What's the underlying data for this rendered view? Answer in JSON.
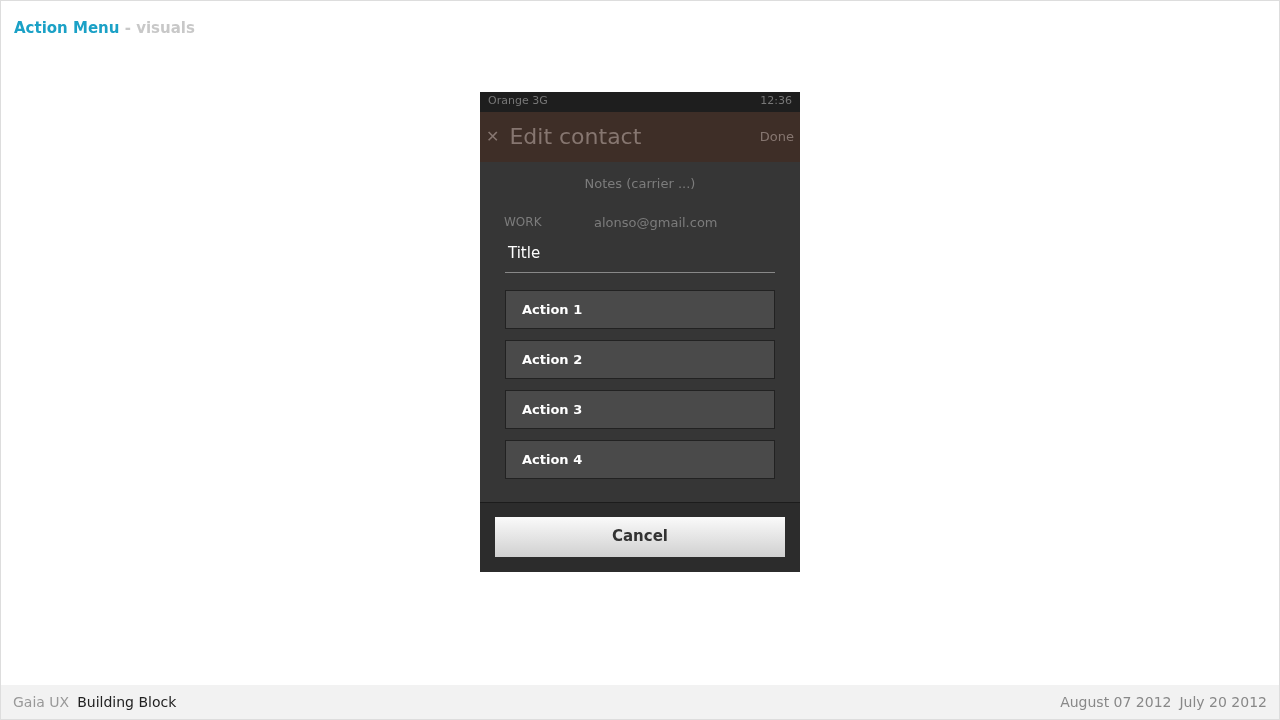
{
  "slide": {
    "title": "Action Menu",
    "subtitle": "- visuals"
  },
  "background_screen": {
    "status_bar": {
      "carrier": "Orange 3G",
      "time": "12:36"
    },
    "header": {
      "close": "✕",
      "title": "Edit contact",
      "done": "Done"
    },
    "notes": "Notes (carrier ...)",
    "email_rows": [
      {
        "type": "WORK",
        "value": "alonso@gmail.com"
      }
    ]
  },
  "action_menu": {
    "title": "Title",
    "actions": [
      "Action 1",
      "Action 2",
      "Action 3",
      "Action 4"
    ],
    "cancel": "Cancel"
  },
  "footer": {
    "product": "Gaia UX",
    "section": "Building Block",
    "dates": [
      "August 07 2012",
      "July 20 2012"
    ]
  }
}
